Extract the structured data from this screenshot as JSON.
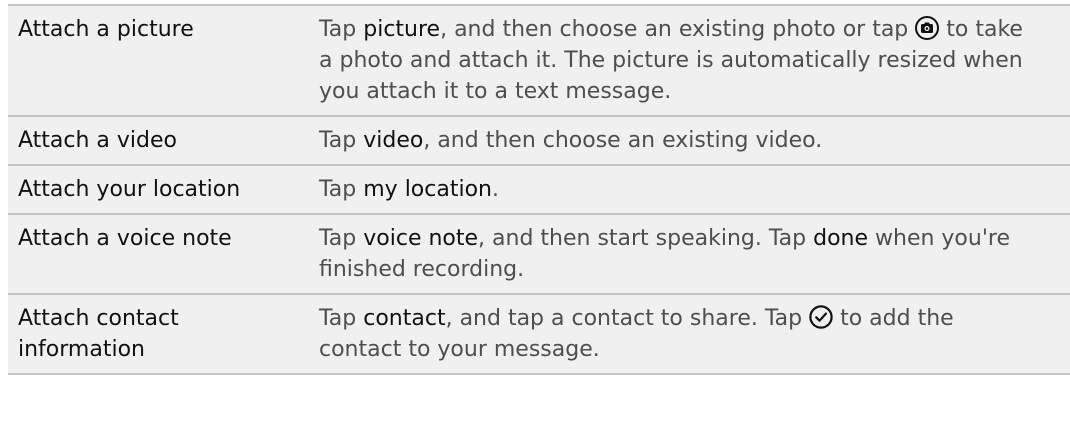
{
  "rows": [
    {
      "action": "Attach a picture",
      "parts": [
        {
          "t": "text",
          "v": "Tap "
        },
        {
          "t": "kw",
          "v": "picture"
        },
        {
          "t": "text",
          "v": ", and then choose an existing photo or tap "
        },
        {
          "t": "icon",
          "v": "camera-icon"
        },
        {
          "t": "text",
          "v": " to take a photo and attach it. The picture is automatically resized when you attach it to a text message."
        }
      ]
    },
    {
      "action": "Attach a video",
      "parts": [
        {
          "t": "text",
          "v": "Tap "
        },
        {
          "t": "kw",
          "v": "video"
        },
        {
          "t": "text",
          "v": ", and then choose an existing video."
        }
      ]
    },
    {
      "action": "Attach your location",
      "parts": [
        {
          "t": "text",
          "v": "Tap "
        },
        {
          "t": "kw",
          "v": "my location"
        },
        {
          "t": "text",
          "v": "."
        }
      ]
    },
    {
      "action": "Attach a voice note",
      "parts": [
        {
          "t": "text",
          "v": "Tap "
        },
        {
          "t": "kw",
          "v": "voice note"
        },
        {
          "t": "text",
          "v": ", and then start speaking. Tap "
        },
        {
          "t": "kw",
          "v": "done"
        },
        {
          "t": "text",
          "v": " when you're finished recording."
        }
      ]
    },
    {
      "action": "Attach contact information",
      "parts": [
        {
          "t": "text",
          "v": "Tap "
        },
        {
          "t": "kw",
          "v": "contact"
        },
        {
          "t": "text",
          "v": ", and tap a contact to share. Tap "
        },
        {
          "t": "icon",
          "v": "checkmark-icon"
        },
        {
          "t": "text",
          "v": " to add the contact to your message."
        }
      ]
    }
  ]
}
